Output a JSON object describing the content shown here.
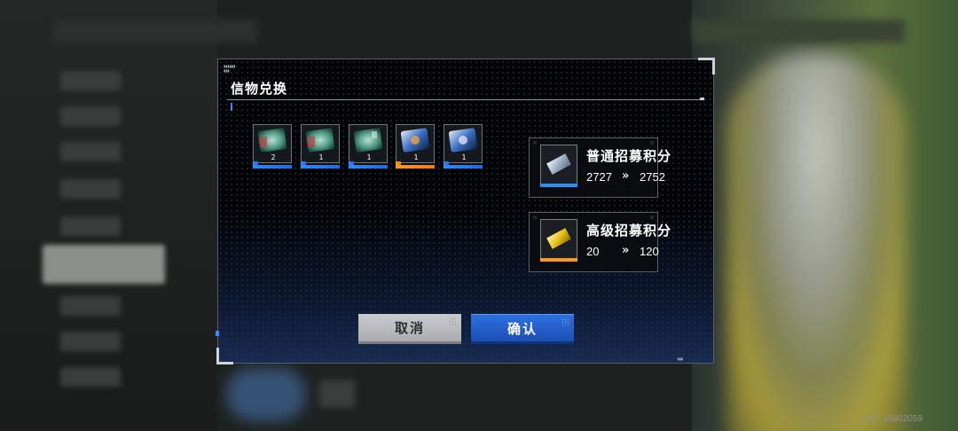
{
  "dialog": {
    "title": "信物兑换",
    "items": [
      {
        "qty": "2",
        "rarity": "blue",
        "art": "green-token-icon"
      },
      {
        "qty": "1",
        "rarity": "blue",
        "art": "green-token-icon"
      },
      {
        "qty": "1",
        "rarity": "blue",
        "art": "green-token-icon"
      },
      {
        "qty": "1",
        "rarity": "orange",
        "art": "blue-token-icon"
      },
      {
        "qty": "1",
        "rarity": "blue",
        "art": "blue-token-icon"
      }
    ],
    "normal_points": {
      "name": "普通招募积分",
      "from": "2727",
      "to": "2752",
      "icon": "silver-ticket-icon",
      "accent": "#2a8cff"
    },
    "senior_points": {
      "name": "高级招募积分",
      "from": "20",
      "to": "120",
      "icon": "gold-ticket-icon",
      "accent": "#ff9a1e"
    },
    "arrow": "»",
    "cancel_label": "取消",
    "confirm_label": "确认"
  },
  "footer": {
    "uid": "UID: 16802059"
  },
  "colors": {
    "blue": "#2a8cff",
    "orange": "#ff9a1e",
    "confirm": "#1f58c4"
  }
}
